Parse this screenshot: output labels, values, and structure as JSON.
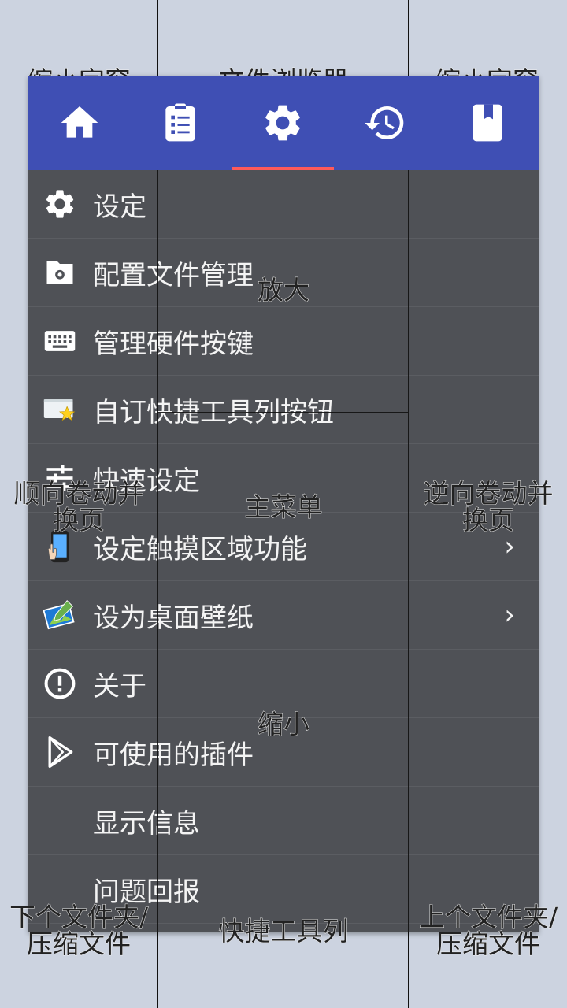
{
  "zones": {
    "top_left": "缩小字窗",
    "top_center": "文件浏览器",
    "top_right": "缩小字窗",
    "zoom_in": "放大",
    "scroll_forward": "顺向卷动并\n换页",
    "main_menu": "主菜单",
    "scroll_backward": "逆向卷动并\n换页",
    "zoom_out": "缩小",
    "next_folder": "下个文件夹/\n压缩文件",
    "toolbar": "快捷工具列",
    "prev_folder": "上个文件夹/\n压缩文件"
  },
  "tabs": [
    {
      "name": "home",
      "icon": "home-icon"
    },
    {
      "name": "list",
      "icon": "clipboard-list-icon"
    },
    {
      "name": "settings",
      "icon": "gear-icon",
      "active": true
    },
    {
      "name": "history",
      "icon": "history-icon"
    },
    {
      "name": "bookmark",
      "icon": "bookmark-icon"
    }
  ],
  "menu": {
    "items": [
      {
        "label": "设定",
        "icon": "gear-icon"
      },
      {
        "label": "配置文件管理",
        "icon": "folder-settings-icon"
      },
      {
        "label": "管理硬件按键",
        "icon": "keyboard-icon"
      },
      {
        "label": "自订快捷工具列按钮",
        "icon": "toolbar-star-icon"
      },
      {
        "label": "快速设定",
        "icon": "sliders-icon"
      },
      {
        "label": "设定触摸区域功能",
        "icon": "touch-phone-icon",
        "submenu": true
      },
      {
        "label": "设为桌面壁纸",
        "icon": "wallpaper-icon",
        "submenu": true
      },
      {
        "label": "关于",
        "icon": "info-icon"
      },
      {
        "label": "可使用的插件",
        "icon": "play-store-icon"
      },
      {
        "label": "显示信息",
        "icon": ""
      },
      {
        "label": "问题回报",
        "icon": ""
      }
    ],
    "chevron": "›"
  },
  "colors": {
    "header": "#3f4fb4",
    "panel": "#4f5156",
    "indicator": "#ff5a5a"
  }
}
